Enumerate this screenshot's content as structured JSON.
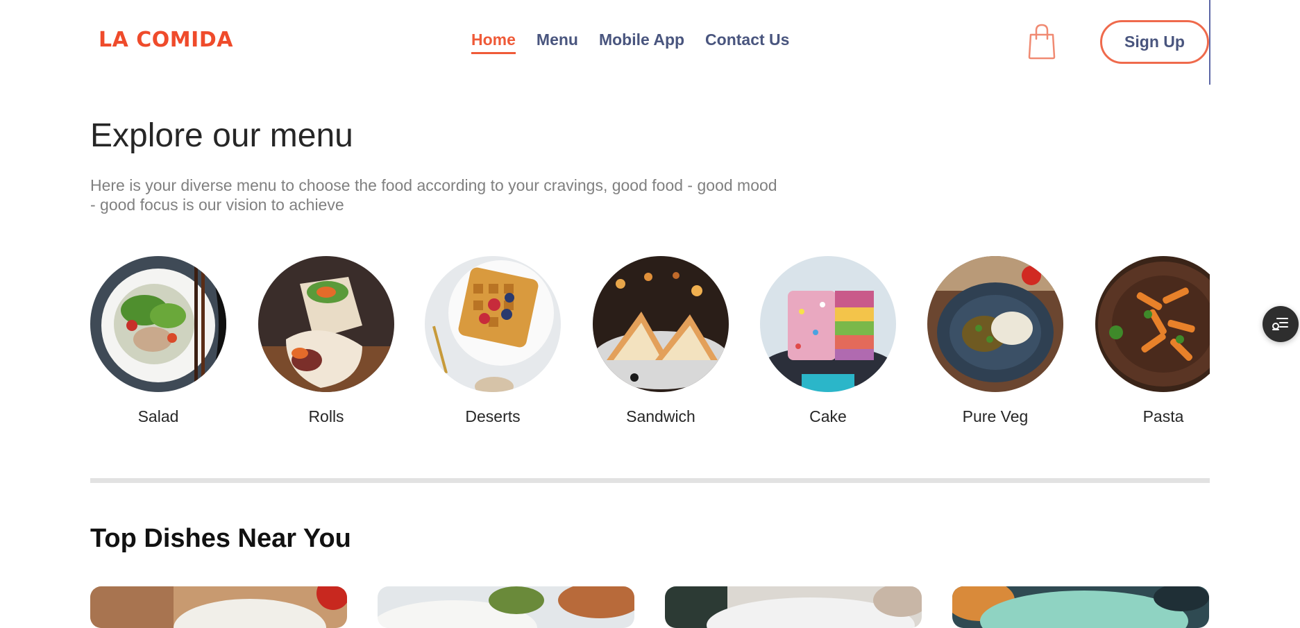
{
  "brand": {
    "logo": "LA COMIDA"
  },
  "nav": {
    "items": [
      {
        "label": "Home",
        "active": true
      },
      {
        "label": "Menu"
      },
      {
        "label": "Mobile App"
      },
      {
        "label": "Contact Us"
      }
    ]
  },
  "header": {
    "cart_icon": "shopping-bag-icon",
    "signup_label": "Sign Up"
  },
  "explore": {
    "title": "Explore our menu",
    "description": "Here is your diverse menu to choose the food according to your cravings, good food - good mood - good focus is our vision to achieve",
    "items": [
      {
        "label": "Salad"
      },
      {
        "label": "Rolls"
      },
      {
        "label": "Deserts"
      },
      {
        "label": "Sandwich"
      },
      {
        "label": "Cake"
      },
      {
        "label": "Pure Veg"
      },
      {
        "label": "Pasta"
      }
    ]
  },
  "top_dishes": {
    "title": "Top Dishes Near You"
  },
  "floating": {
    "icon": "settings-list-icon"
  },
  "colors": {
    "accent": "#ef4b2b",
    "nav_text": "#49557e",
    "divider": "#e2e2e2"
  }
}
